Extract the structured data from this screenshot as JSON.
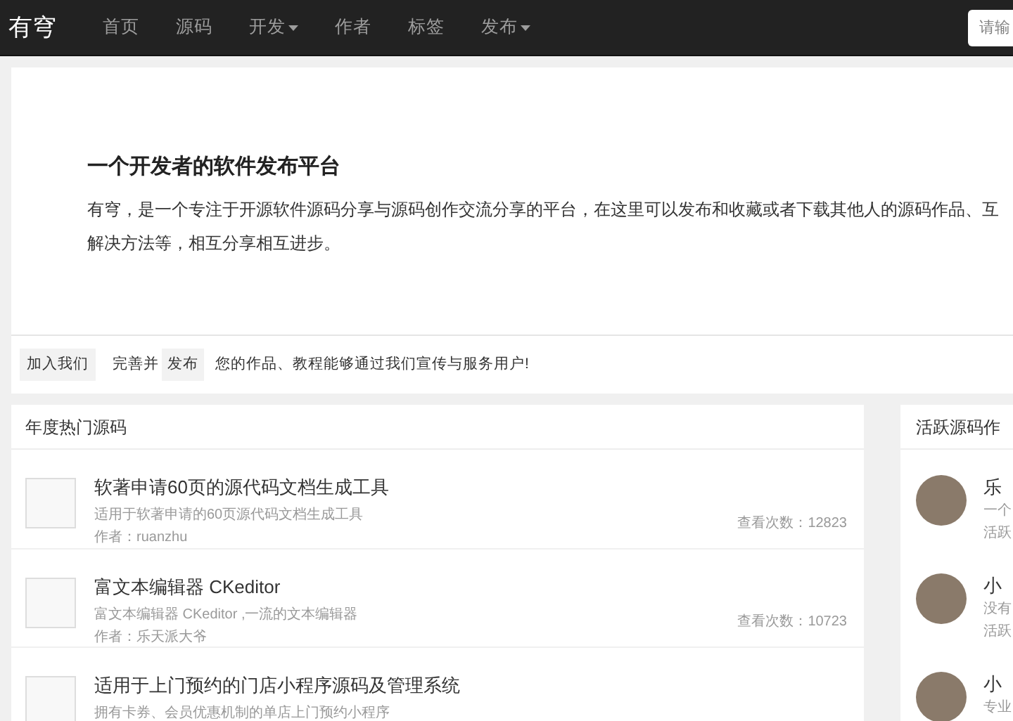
{
  "nav": {
    "logo": "有穹",
    "items": [
      {
        "label": "首页",
        "dropdown": false
      },
      {
        "label": "源码",
        "dropdown": false
      },
      {
        "label": "开发",
        "dropdown": true
      },
      {
        "label": "作者",
        "dropdown": false
      },
      {
        "label": "标签",
        "dropdown": false
      },
      {
        "label": "发布",
        "dropdown": true
      }
    ],
    "search": {
      "placeholder": "请输"
    }
  },
  "hero": {
    "title": "一个开发者的软件发布平台",
    "text": "有穹，是一个专注于开源软件源码分享与源码创作交流分享的平台，在这里可以发布和收藏或者下载其他人的源码作品、互解决方法等，相互分享相互进步。"
  },
  "join_bar": {
    "join": "加入我们",
    "prefix": "完善并",
    "publish": "发布",
    "text": "您的作品、教程能够通过我们宣传与服务用户!"
  },
  "hot": {
    "title": "年度热门源码",
    "items": [
      {
        "title": "软著申请60页的源代码文档生成工具",
        "desc": "适用于软著申请的60页源代码文档生成工具",
        "author": "作者：ruanzhu",
        "views": "查看次数：12823"
      },
      {
        "title": "富文本编辑器 CKeditor",
        "desc": "富文本编辑器 CKeditor ,一流的文本编辑器",
        "author": "作者：乐天派大爷",
        "views": "查看次数：10723"
      },
      {
        "title": "适用于上门预约的门店小程序源码及管理系统",
        "desc": "拥有卡券、会员优惠机制的单店上门预约小程序"
      }
    ]
  },
  "authors": {
    "title": "活跃源码作",
    "items": [
      {
        "name": "乐",
        "desc": "一个",
        "activity": "活跃"
      },
      {
        "name": "小",
        "desc": "没有",
        "activity": "活跃"
      },
      {
        "name": "小",
        "desc": "专业"
      }
    ]
  }
}
